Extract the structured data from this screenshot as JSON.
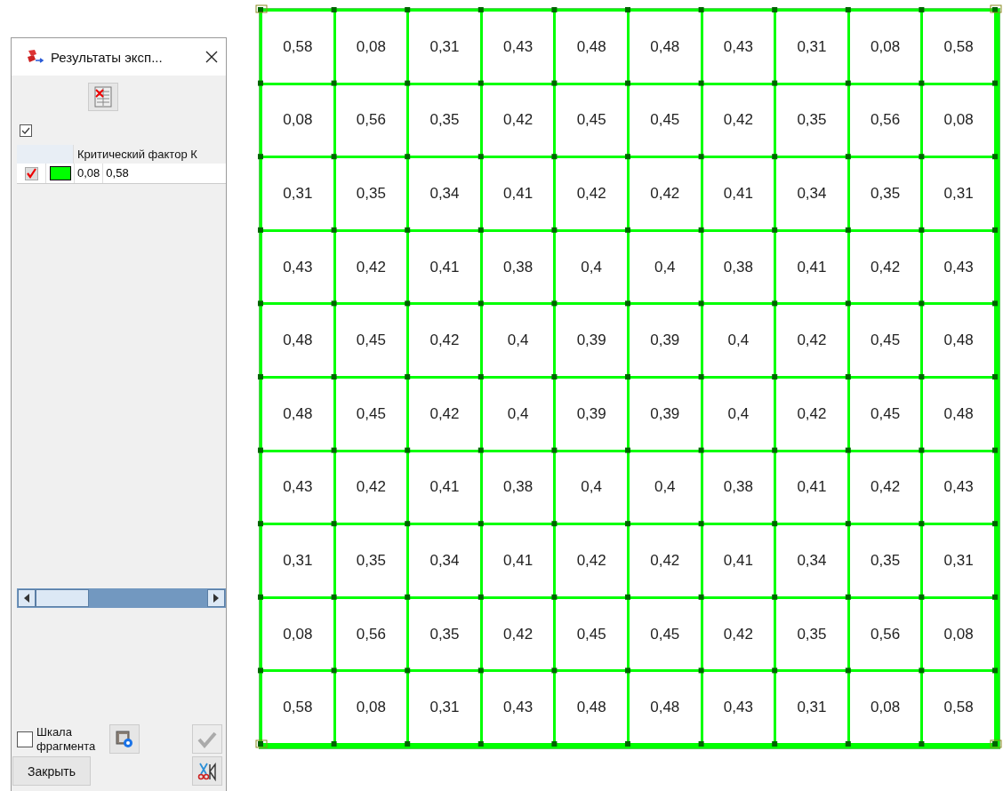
{
  "panel": {
    "title": "Результаты эксп...",
    "show_all_checked": true,
    "table": {
      "columns": [
        "Критический фактор К"
      ],
      "rows": [
        {
          "visible": true,
          "color": "#00ff00",
          "min": "0,08",
          "max": "0,58"
        }
      ]
    },
    "scale_checkbox": {
      "label": "Шкала фрагмента",
      "checked": false
    },
    "apply_disabled": true,
    "close_button": "Закрыть"
  },
  "grid": {
    "rows": [
      [
        "0,58",
        "0,08",
        "0,31",
        "0,43",
        "0,48",
        "0,48",
        "0,43",
        "0,31",
        "0,08",
        "0,58"
      ],
      [
        "0,08",
        "0,56",
        "0,35",
        "0,42",
        "0,45",
        "0,45",
        "0,42",
        "0,35",
        "0,56",
        "0,08"
      ],
      [
        "0,31",
        "0,35",
        "0,34",
        "0,41",
        "0,42",
        "0,42",
        "0,41",
        "0,34",
        "0,35",
        "0,31"
      ],
      [
        "0,43",
        "0,42",
        "0,41",
        "0,38",
        "0,4",
        "0,4",
        "0,38",
        "0,41",
        "0,42",
        "0,43"
      ],
      [
        "0,48",
        "0,45",
        "0,42",
        "0,4",
        "0,39",
        "0,39",
        "0,4",
        "0,42",
        "0,45",
        "0,48"
      ],
      [
        "0,48",
        "0,45",
        "0,42",
        "0,4",
        "0,39",
        "0,39",
        "0,4",
        "0,42",
        "0,45",
        "0,48"
      ],
      [
        "0,43",
        "0,42",
        "0,41",
        "0,38",
        "0,4",
        "0,4",
        "0,38",
        "0,41",
        "0,42",
        "0,43"
      ],
      [
        "0,31",
        "0,35",
        "0,34",
        "0,41",
        "0,42",
        "0,42",
        "0,41",
        "0,34",
        "0,35",
        "0,31"
      ],
      [
        "0,08",
        "0,56",
        "0,35",
        "0,42",
        "0,45",
        "0,45",
        "0,42",
        "0,35",
        "0,56",
        "0,08"
      ],
      [
        "0,58",
        "0,08",
        "0,31",
        "0,43",
        "0,48",
        "0,48",
        "0,43",
        "0,31",
        "0,08",
        "0,58"
      ]
    ]
  }
}
